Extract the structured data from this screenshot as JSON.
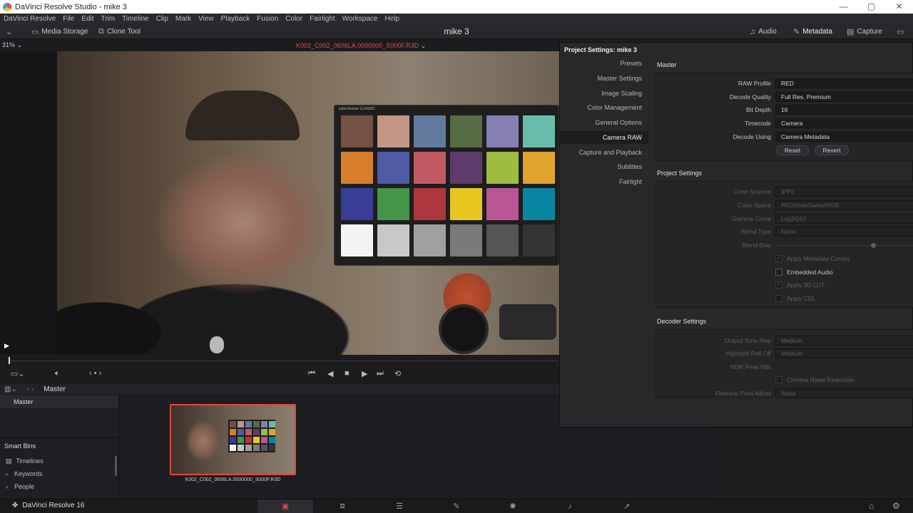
{
  "titlebar": {
    "title": "DaVinci Resolve Studio - mike 3",
    "minimize": "—",
    "maximize": "▢",
    "close": "✕"
  },
  "menu": [
    "DaVinci Resolve",
    "File",
    "Edit",
    "Trim",
    "Timeline",
    "Clip",
    "Mark",
    "View",
    "Playback",
    "Fusion",
    "Color",
    "Fairlight",
    "Workspace",
    "Help"
  ],
  "toolbar": {
    "media_storage": "Media Storage",
    "clone_tool": "Clone Tool",
    "project_name": "mike 3",
    "audio": "Audio",
    "metadata": "Metadata",
    "capture": "Capture"
  },
  "viewer": {
    "zoom": "31%",
    "clip_name": "K002_C002_0606LA.0000000_S000F.R3D",
    "checker_brand": "colorchecker CLASSIC",
    "checker_colors": [
      "#735244",
      "#c29682",
      "#627a9d",
      "#576c43",
      "#8580b1",
      "#67bdaa",
      "#d67e2c",
      "#505ba6",
      "#c15a63",
      "#5e3c6c",
      "#9dbc40",
      "#e0a32e",
      "#383d96",
      "#469449",
      "#af363c",
      "#e7c71f",
      "#bb5695",
      "#0885a1",
      "#f3f3f2",
      "#c8c8c8",
      "#a0a0a0",
      "#7a7a79",
      "#555555",
      "#343434"
    ]
  },
  "media_pool": {
    "breadcrumb": "Master",
    "master_bin": "Master",
    "smart_bins_title": "Smart Bins",
    "smart_bins": [
      "Timelines",
      "Keywords",
      "People"
    ],
    "clip_caption": "K002_C002_0606LA.0000000_S000F.R3D"
  },
  "pagebar": {
    "app_label": "DaVinci Resolve 16"
  },
  "dialog": {
    "title": "Project Settings:  mike 3",
    "nav": [
      "Presets",
      "Master Settings",
      "Image Scaling",
      "Color Management",
      "General Options",
      "Camera RAW",
      "Capture and Playback",
      "Subtitles",
      "Fairlight"
    ],
    "active_nav": "Camera RAW",
    "master": {
      "title": "Master",
      "rows": [
        {
          "label": "RAW Profile",
          "value": "RED"
        },
        {
          "label": "Decode Quality",
          "value": "Full Res. Premium"
        },
        {
          "label": "Bit Depth",
          "value": "16"
        },
        {
          "label": "Timecode",
          "value": "Camera"
        },
        {
          "label": "Decode Using",
          "value": "Camera Metadata"
        }
      ],
      "reset": "Reset",
      "revert": "Revert"
    },
    "project_settings": {
      "title": "Project Settings",
      "rows": [
        {
          "label": "Color Science",
          "value": "IPP2"
        },
        {
          "label": "Color Space",
          "value": "REDWideGamutRGB"
        },
        {
          "label": "Gamma Curve",
          "value": "Log3G10"
        },
        {
          "label": "Blend Type",
          "value": "None"
        }
      ],
      "blend_bias": "Blend Bias",
      "checks": [
        {
          "label": "Apply Metadata Curves",
          "checked": true,
          "dim": true
        },
        {
          "label": "Embedded Audio",
          "checked": false,
          "dim": false
        },
        {
          "label": "Apply 3D LUT",
          "checked": true,
          "dim": true
        },
        {
          "label": "Apply CDL",
          "checked": false,
          "dim": true
        }
      ]
    },
    "decoder": {
      "title": "Decoder Settings",
      "output_tone_map": {
        "label": "Output Tone Map",
        "value": "Medium"
      },
      "highlight_roll_off": {
        "label": "Highlight Roll Off",
        "value": "Medium"
      },
      "hdr_peak_nits": "HDR Peak Nits",
      "chroma_noise": "Chroma Noise Reduction",
      "flashing_pixel": {
        "label": "Flashing Pixel Adjust",
        "value": "None"
      }
    }
  }
}
